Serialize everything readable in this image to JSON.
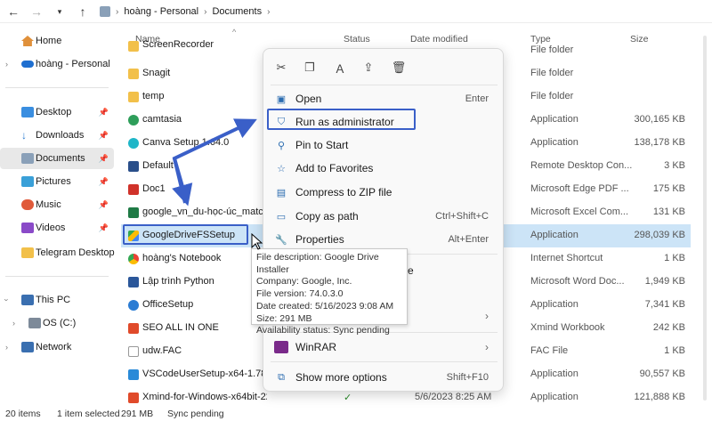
{
  "address": {
    "path": [
      "hoàng - Personal",
      "Documents"
    ]
  },
  "sidebar": {
    "items": [
      {
        "label": "Home"
      },
      {
        "label": "hoàng - Personal"
      },
      {
        "label": "Desktop"
      },
      {
        "label": "Downloads"
      },
      {
        "label": "Documents"
      },
      {
        "label": "Pictures"
      },
      {
        "label": "Music"
      },
      {
        "label": "Videos"
      },
      {
        "label": "Telegram Desktop"
      },
      {
        "label": "This PC"
      },
      {
        "label": "OS (C:)"
      },
      {
        "label": "Network"
      }
    ]
  },
  "columns": {
    "name": "Name",
    "status": "Status",
    "date": "Date modified",
    "type": "Type",
    "size": "Size"
  },
  "files": [
    {
      "name": "ScreenRecorder",
      "type": "File folder",
      "size": "",
      "icon": "folder-icon"
    },
    {
      "name": "Snagit",
      "type": "File folder",
      "size": "",
      "icon": "folder-icon"
    },
    {
      "name": "temp",
      "type": "File folder",
      "size": "",
      "icon": "folder-icon"
    },
    {
      "name": "camtasia",
      "type": "Application",
      "size": "300,165 KB",
      "icon": "camtasia-icon"
    },
    {
      "name": "Canva Setup 1.64.0",
      "type": "Application",
      "size": "138,178 KB",
      "icon": "canva-icon"
    },
    {
      "name": "Default",
      "type": "Remote Desktop Con...",
      "size": "3 KB",
      "icon": "remote-desktop-icon"
    },
    {
      "name": "Doc1",
      "type": "Microsoft Edge PDF ...",
      "size": "175 KB",
      "icon": "pdf-icon"
    },
    {
      "name": "google_vn_du-học-úc_matching",
      "type": "Microsoft Excel Com...",
      "size": "131 KB",
      "icon": "excel-icon"
    },
    {
      "name": "GoogleDriveFSSetup",
      "type": "Application",
      "size": "298,039 KB",
      "icon": "google-drive-icon"
    },
    {
      "name": "hoàng's Notebook",
      "type": "Internet Shortcut",
      "size": "1 KB",
      "icon": "chrome-icon"
    },
    {
      "name": "Lập trình Python",
      "type": "Microsoft Word Doc...",
      "size": "1,949 KB",
      "icon": "word-icon"
    },
    {
      "name": "OfficeSetup",
      "type": "Application",
      "size": "7,341 KB",
      "icon": "office-icon"
    },
    {
      "name": "SEO ALL IN ONE",
      "type": "Xmind Workbook",
      "size": "242 KB",
      "icon": "xmind-icon"
    },
    {
      "name": "udw.FAC",
      "type": "FAC File",
      "size": "1 KB",
      "icon": "file-icon"
    },
    {
      "name": "VSCodeUserSetup-x64-1.78.0",
      "type": "Application",
      "size": "90,557 KB",
      "icon": "vscode-icon"
    },
    {
      "name": "Xmind-for-Windows-x64bit-22.11.3656",
      "type": "Application",
      "size": "121,888 KB",
      "icon": "xmind-icon",
      "date": "5/6/2023 8:25 AM"
    }
  ],
  "context_menu": {
    "items": [
      {
        "label": "Open",
        "shortcut": "Enter"
      },
      {
        "label": "Run as administrator",
        "shortcut": ""
      },
      {
        "label": "Pin to Start",
        "shortcut": ""
      },
      {
        "label": "Add to Favorites",
        "shortcut": ""
      },
      {
        "label": "Compress to ZIP file",
        "shortcut": ""
      },
      {
        "label": "Copy as path",
        "shortcut": "Ctrl+Shift+C"
      },
      {
        "label": "Properties",
        "shortcut": "Alt+Enter"
      },
      {
        "label": "WinRAR",
        "shortcut": ""
      },
      {
        "label": "Show more options",
        "shortcut": "Shift+F10"
      }
    ],
    "partial_label": "ce"
  },
  "tooltip": {
    "lines": [
      "File description: Google Drive Installer",
      "Company: Google, Inc.",
      "File version: 74.0.3.0",
      "Date created: 5/16/2023 9:08 AM",
      "Size: 291 MB",
      "Availability status: Sync pending"
    ]
  },
  "statusbar": {
    "items": "20 items",
    "selected": "1 item selected",
    "size": "291 MB",
    "sync": "Sync pending"
  },
  "colors": {
    "accent": "#3a5fc8",
    "selection": "#cce4f7"
  }
}
